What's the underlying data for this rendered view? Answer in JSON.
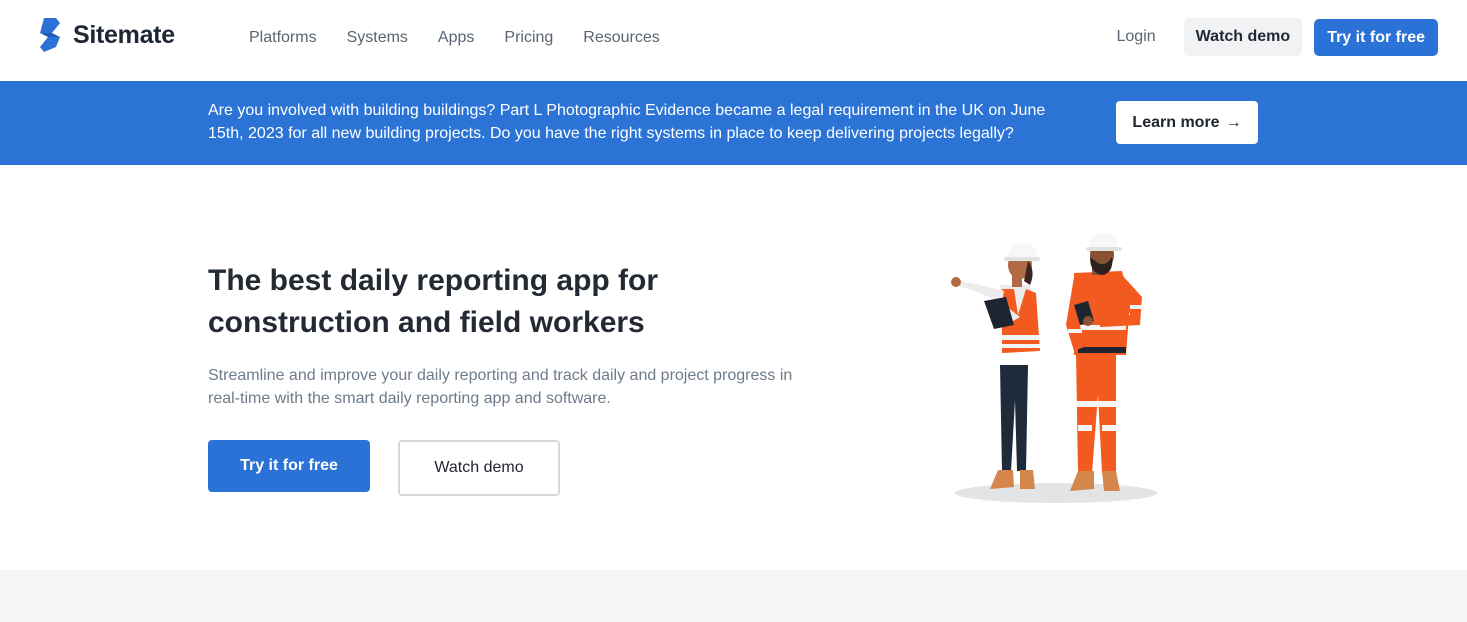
{
  "brand": {
    "name": "Sitemate",
    "logo_icon": "sitemate-logo-icon",
    "accent_color": "#2b72d6"
  },
  "nav": {
    "links": [
      "Platforms",
      "Systems",
      "Apps",
      "Pricing",
      "Resources"
    ],
    "login_label": "Login",
    "watch_demo_label": "Watch demo",
    "try_free_label": "Try it for free"
  },
  "banner": {
    "text": "Are you involved with building buildings? Part L Photographic Evidence became a legal requirement in the UK on June 15th, 2023 for all new building projects. Do you have the right systems in place to keep delivering projects legally?",
    "cta_label": "Learn more",
    "cta_arrow": "→",
    "background_color": "#2b74d6"
  },
  "hero": {
    "title": "The best daily reporting app for construction and field workers",
    "subtitle": "Streamline and improve your daily reporting and track daily and project progress in real-time with the smart daily reporting app and software.",
    "primary_cta_label": "Try it for free",
    "secondary_cta_label": "Watch demo",
    "illustration": "construction-workers-illustration"
  }
}
